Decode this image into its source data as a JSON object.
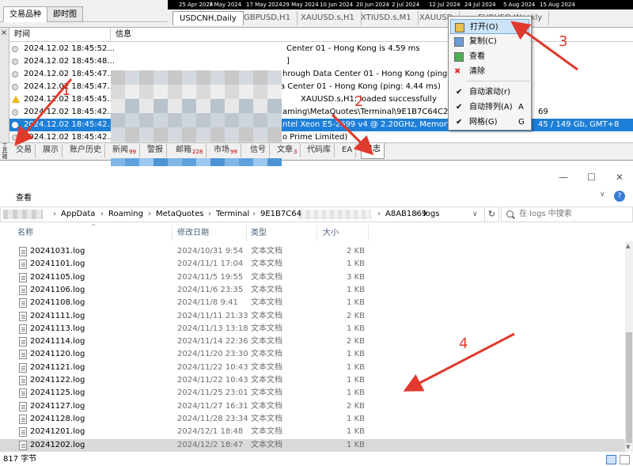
{
  "colors": {
    "accent": "#1e7fd8",
    "annotation": "#e03a2e",
    "badge": "#c00000",
    "selection_row": "#d9d9d9"
  },
  "date_bar": [
    "25 Apr 2024",
    "7 May 2024",
    "17 May 2024",
    "29 May 2024",
    "10 Jun 2024",
    "20 Jun 2024",
    "2 Jul 2024",
    "12 Jul 2024",
    "24 Jul 2024",
    "5 Aug 2024",
    "15 Aug 2024"
  ],
  "market_watch": {
    "tabs": [
      "交易品种",
      "即时图"
    ]
  },
  "chart_tabs": [
    "USDCNH,Daily",
    "GBPUSD,H1",
    "XAUUSD.s,H1",
    "XTIUSD.s,M1",
    "XAUUSD",
    "EURUSD,Weekly"
  ],
  "toolbox": {
    "close_glyph": "×",
    "label": "工具箱",
    "columns": {
      "time": "时间",
      "message": "信息"
    },
    "rows": [
      {
        "time": "2024.12.02 18:45:52...",
        "message": "Center 01 - Hong Kong is 4.59 ms",
        "icon": "info-icon"
      },
      {
        "time": "2024.12.02 18:45:48...",
        "message": "]",
        "icon": "info-icon"
      },
      {
        "time": "2024.12.02 18:45:47...",
        "message": "hrough Data Center 01 - Hong Kong (ping: 4.49 ms)",
        "icon": "info-icon"
      },
      {
        "time": "2024.12.02 18:45:47...",
        "message": "a Center 01 - Hong Kong (ping: 4.44 ms)",
        "icon": "info-icon"
      },
      {
        "time": "2024.12.02 18:45:45...",
        "message": "XAUUSD.s,H1: loaded successfully",
        "icon": "warning-icon"
      },
      {
        "time": "2024.12.02 18:45:42...",
        "message": "aming\\MetaQuotes\\Terminal\\9E1B7C64C22D",
        "icon": "info-icon"
      },
      {
        "time": "2024.12.02 18:45:42...",
        "message": "ntel Xeon  E5-2699 v4 @ 2.20GHz, Memory:",
        "tail": "45 / 149 Gb, GMT+8",
        "icon": "info-icon",
        "selected": true
      },
      {
        "time": "2024.12.02 18:45:42...",
        "message": "o Prime Limited)",
        "icon": "info-icon"
      }
    ],
    "tail_69": "69",
    "bottom_tabs": [
      {
        "label": "交易",
        "badge": ""
      },
      {
        "label": "展示",
        "badge": ""
      },
      {
        "label": "账户历史",
        "badge": ""
      },
      {
        "label": "新闻",
        "badge": "99"
      },
      {
        "label": "警报",
        "badge": ""
      },
      {
        "label": "邮箱",
        "badge": "228"
      },
      {
        "label": "市场",
        "badge": "99"
      },
      {
        "label": "信号",
        "badge": ""
      },
      {
        "label": "文章",
        "badge": "3"
      },
      {
        "label": "代码库",
        "badge": ""
      },
      {
        "label": "EA",
        "badge": ""
      },
      {
        "label": "日志",
        "badge": "",
        "active": true
      }
    ]
  },
  "context_menu": [
    {
      "label": "打开(O)",
      "shortcut": "",
      "icon": "open-folder-icon",
      "highlight": true
    },
    {
      "label": "复制(C)",
      "shortcut": "",
      "icon": "copy-icon"
    },
    {
      "label": "查看",
      "shortcut": "",
      "icon": "view-icon"
    },
    {
      "label": "清除",
      "shortcut": "",
      "icon": "delete-icon"
    },
    {
      "label": "自动滚动(r)",
      "shortcut": "",
      "checked": true
    },
    {
      "label": "自动排列(A)",
      "shortcut": "A",
      "checked": true
    },
    {
      "label": "网格(G)",
      "shortcut": "G",
      "checked": true
    }
  ],
  "explorer": {
    "window_buttons": [
      "—",
      "☐",
      "✕"
    ],
    "ribbon_view": "查看",
    "help_glyph": "?",
    "collapse_glyph": "∨",
    "address": [
      "AppData",
      "Roaming",
      "MetaQuotes",
      "Terminal",
      "9E1B7C64",
      "A8AB1869",
      "logs"
    ],
    "search_placeholder": "在 logs 中搜索",
    "columns": {
      "name": "名称",
      "date": "修改日期",
      "type": "类型",
      "size": "大小"
    },
    "files": [
      {
        "name": "20241031.log",
        "date": "2024/10/31 9:54",
        "type": "文本文档",
        "size": "2 KB"
      },
      {
        "name": "20241101.log",
        "date": "2024/11/1 17:04",
        "type": "文本文档",
        "size": "1 KB"
      },
      {
        "name": "20241105.log",
        "date": "2024/11/5 19:55",
        "type": "文本文档",
        "size": "3 KB"
      },
      {
        "name": "20241106.log",
        "date": "2024/11/6 23:35",
        "type": "文本文档",
        "size": "1 KB"
      },
      {
        "name": "20241108.log",
        "date": "2024/11/8 9:41",
        "type": "文本文档",
        "size": "1 KB"
      },
      {
        "name": "20241111.log",
        "date": "2024/11/11 21:33",
        "type": "文本文档",
        "size": "2 KB"
      },
      {
        "name": "20241113.log",
        "date": "2024/11/13 13:18",
        "type": "文本文档",
        "size": "1 KB"
      },
      {
        "name": "20241114.log",
        "date": "2024/11/14 22:36",
        "type": "文本文档",
        "size": "2 KB"
      },
      {
        "name": "20241120.log",
        "date": "2024/11/20 23:30",
        "type": "文本文档",
        "size": "1 KB"
      },
      {
        "name": "20241121.log",
        "date": "2024/11/22 10:43",
        "type": "文本文档",
        "size": "1 KB"
      },
      {
        "name": "20241122.log",
        "date": "2024/11/22 10:43",
        "type": "文本文档",
        "size": "1 KB"
      },
      {
        "name": "20241125.log",
        "date": "2024/11/25 23:01",
        "type": "文本文档",
        "size": "1 KB"
      },
      {
        "name": "20241127.log",
        "date": "2024/11/27 16:31",
        "type": "文本文档",
        "size": "2 KB"
      },
      {
        "name": "20241128.log",
        "date": "2024/11/28 23:34",
        "type": "文本文档",
        "size": "1 KB"
      },
      {
        "name": "20241201.log",
        "date": "2024/12/1 18:48",
        "type": "文本文档",
        "size": "1 KB"
      },
      {
        "name": "20241202.log",
        "date": "2024/12/2 18:47",
        "type": "文本文档",
        "size": "1 KB",
        "selected": true
      }
    ],
    "status_count": "817 字节"
  },
  "annotations": [
    "1",
    "2",
    "3",
    "4"
  ]
}
